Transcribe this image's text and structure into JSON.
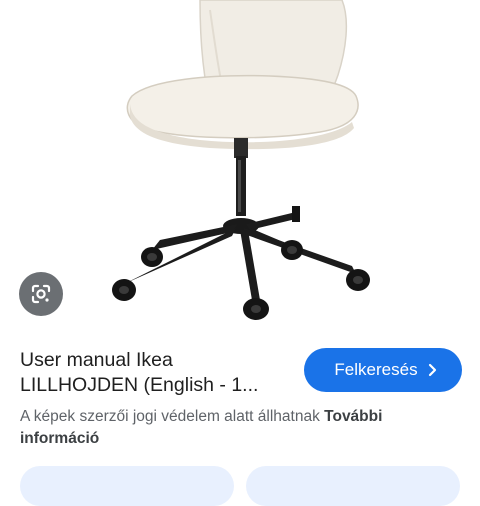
{
  "image": {
    "alt": "",
    "subject_icon": "office-chair"
  },
  "lens": {
    "icon": "google-lens-icon"
  },
  "result": {
    "title_line1": "User manual Ikea",
    "title_line2": "LILLHOJDEN (English - 1..."
  },
  "visit_button": {
    "label": "Felkeresés",
    "icon": "chevron-right-icon",
    "color": "#1a73e8"
  },
  "notice": {
    "text": "A képek szerzői jogi védelem alatt állhatnak ",
    "more_link_line1": "További",
    "more_link_line2": "információ"
  },
  "bottom_chips": {
    "color": "#e8f0fe"
  }
}
